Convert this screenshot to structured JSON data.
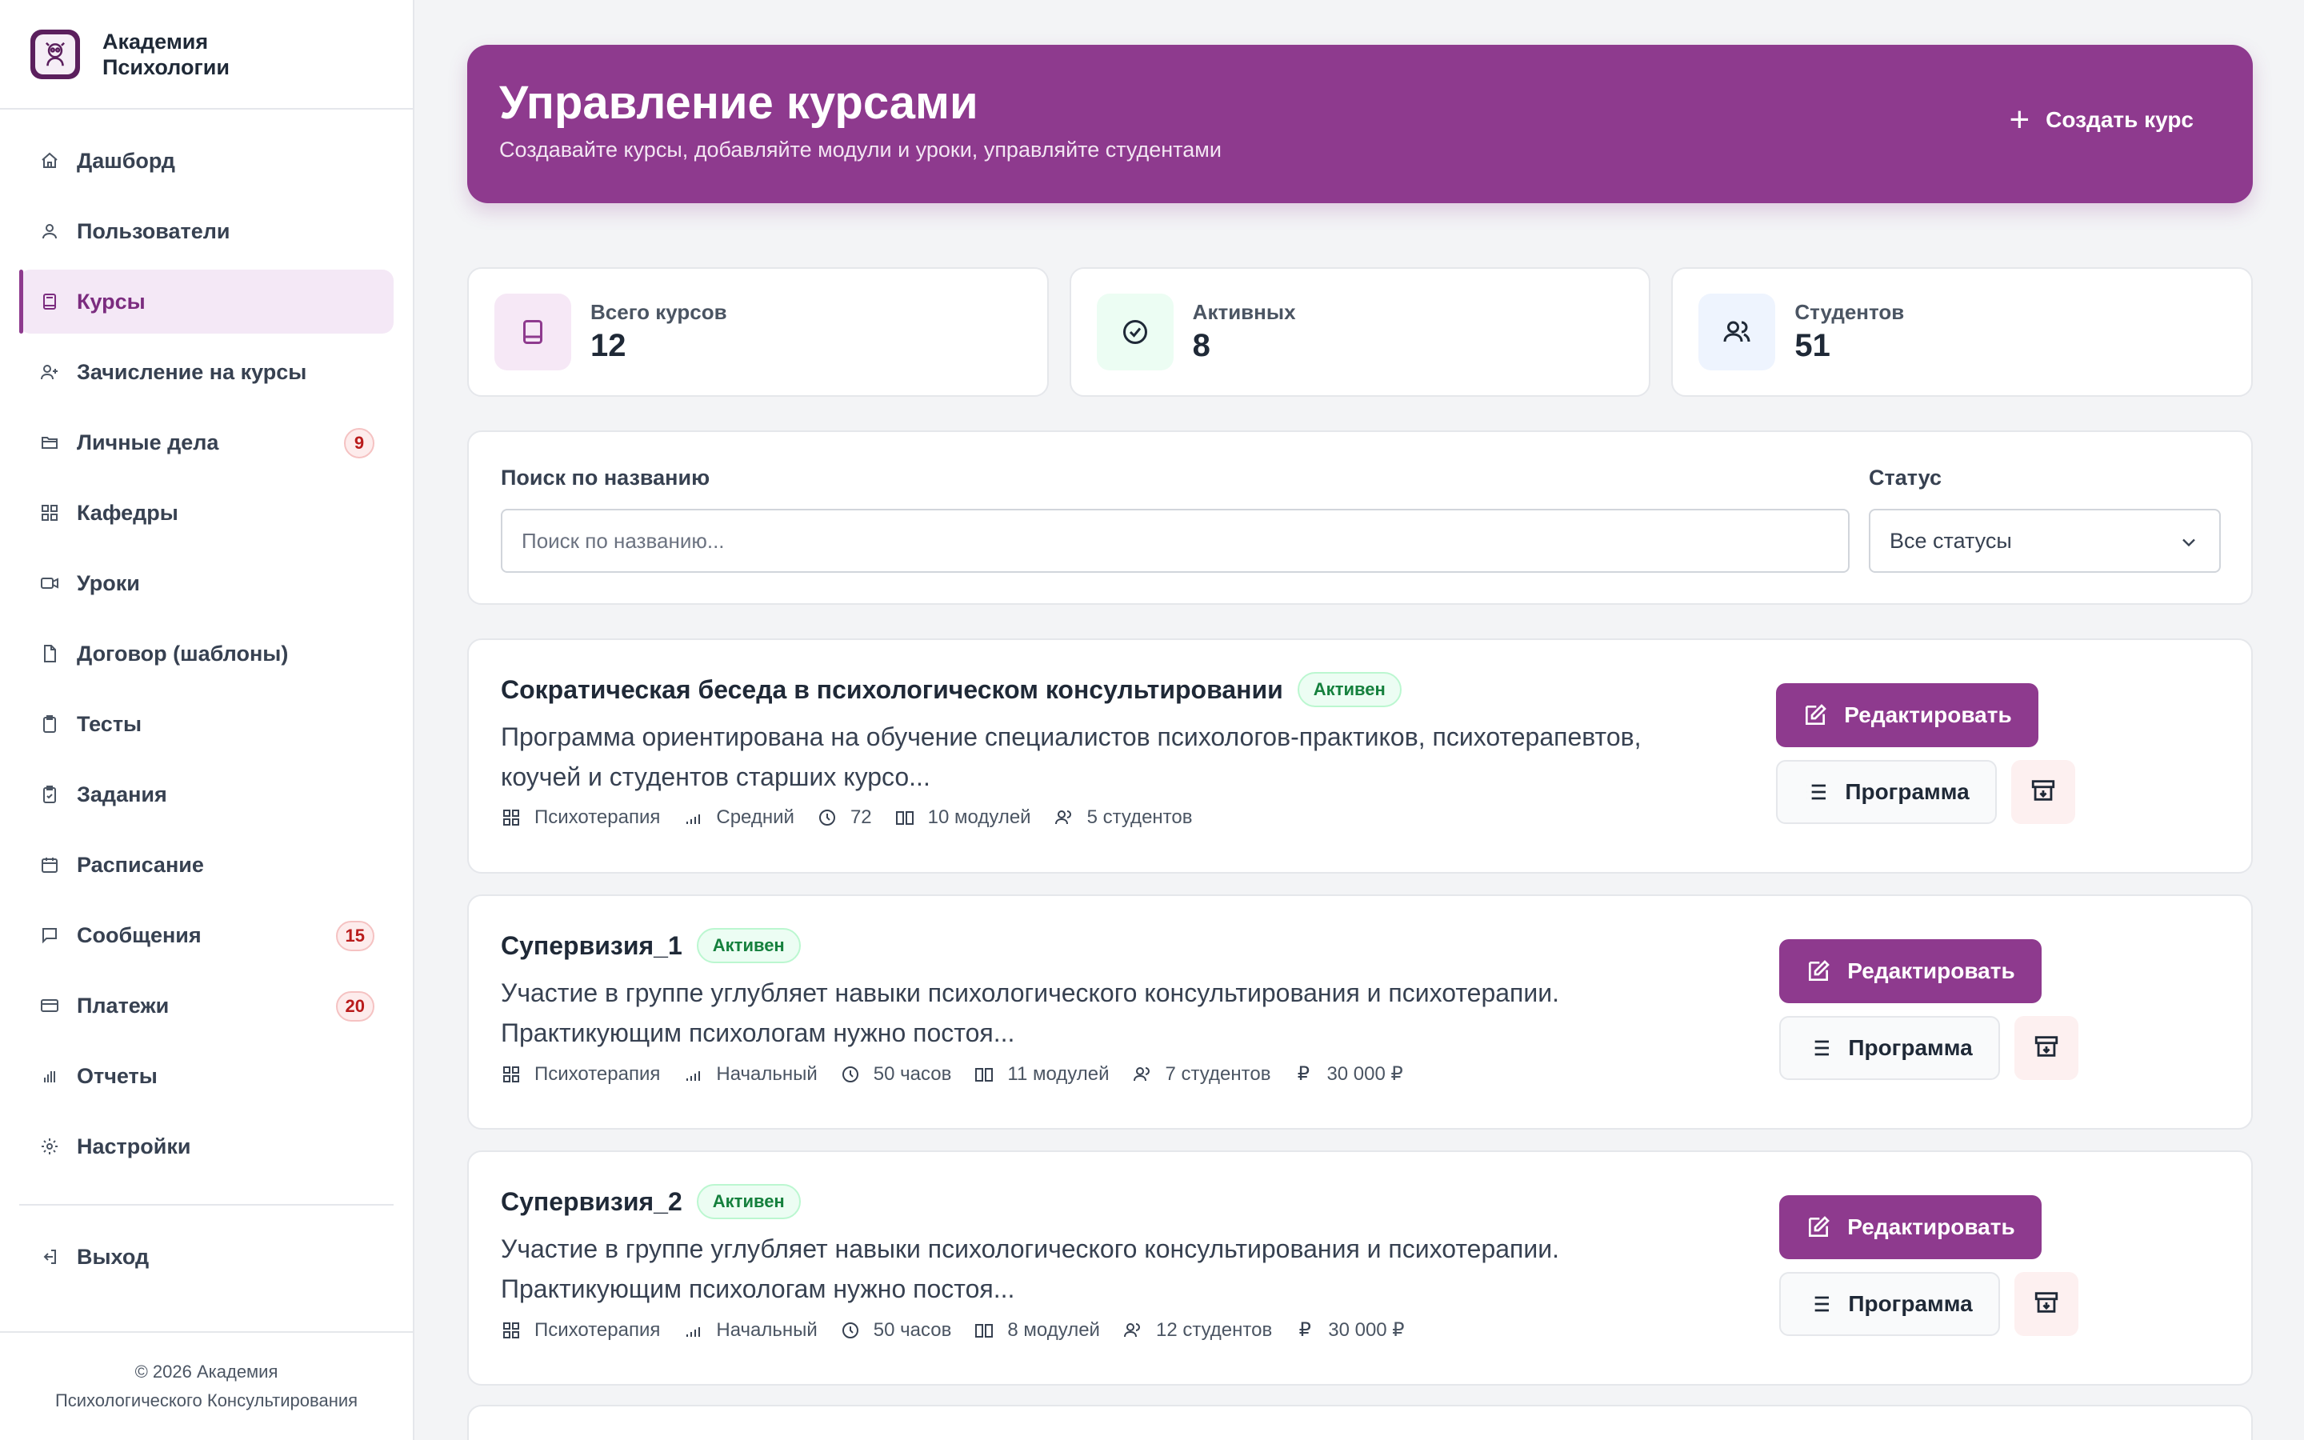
{
  "brand": {
    "title": "Академия Психологии"
  },
  "sidebar": {
    "items": [
      {
        "label": "Дашборд",
        "icon": "home-icon"
      },
      {
        "label": "Пользователи",
        "icon": "user-icon"
      },
      {
        "label": "Курсы",
        "icon": "book-icon",
        "active": true
      },
      {
        "label": "Зачисление на курсы",
        "icon": "user-plus-icon"
      },
      {
        "label": "Личные дела",
        "icon": "folder-icon",
        "badge": "9"
      },
      {
        "label": "Кафедры",
        "icon": "grid-icon"
      },
      {
        "label": "Уроки",
        "icon": "video-icon"
      },
      {
        "label": "Договор (шаблоны)",
        "icon": "file-icon"
      },
      {
        "label": "Тесты",
        "icon": "clipboard-icon"
      },
      {
        "label": "Задания",
        "icon": "clipboard-check-icon"
      },
      {
        "label": "Расписание",
        "icon": "calendar-icon"
      },
      {
        "label": "Сообщения",
        "icon": "message-icon",
        "badge": "15"
      },
      {
        "label": "Платежи",
        "icon": "credit-card-icon",
        "badge": "20"
      },
      {
        "label": "Отчеты",
        "icon": "bar-chart-icon"
      },
      {
        "label": "Настройки",
        "icon": "gear-icon"
      }
    ],
    "logout": "Выход",
    "footer_line1": "© 2026 Академия",
    "footer_line2": "Психологического Консультирования"
  },
  "header": {
    "title": "Управление курсами",
    "subtitle": "Создавайте курсы, добавляйте модули и уроки, управляйте студентами",
    "create_label": "Создать курс"
  },
  "stats": [
    {
      "label": "Всего курсов",
      "value": "12",
      "icon": "book-icon",
      "bg": "#f6e8f6"
    },
    {
      "label": "Активных",
      "value": "8",
      "icon": "check-circle-icon",
      "bg": "#ecfdf3"
    },
    {
      "label": "Студентов",
      "value": "51",
      "icon": "users-icon",
      "bg": "#eef4fe"
    }
  ],
  "filters": {
    "search_label": "Поиск по названию",
    "search_placeholder": "Поиск по названию...",
    "status_label": "Статус",
    "status_value": "Все статусы"
  },
  "courses": [
    {
      "title": "Сократическая беседа в психологическом консультировании",
      "status": "Активен",
      "description": "Программа ориентирована на обучение специалистов психологов-практиков, психотерапевтов, коучей и студентов старших курсо...",
      "category": "Психотерапия",
      "level": "Средний",
      "duration": "72",
      "modules": "10 модулей",
      "students": "5 студентов",
      "price": ""
    },
    {
      "title": "Супервизия_1",
      "status": "Активен",
      "description": "Участие в группе углубляет навыки психологического консультирования и психотерапии. Практикующим психологам нужно постоя...",
      "category": "Психотерапия",
      "level": "Начальный",
      "duration": "50 часов",
      "modules": "11 модулей",
      "students": "7 студентов",
      "price": "30 000 ₽"
    },
    {
      "title": "Супервизия_2",
      "status": "Активен",
      "description": "Участие в группе углубляет навыки психологического консультирования и психотерапии. Практикующим психологам нужно постоя...",
      "category": "Психотерапия",
      "level": "Начальный",
      "duration": "50 часов",
      "modules": "8 модулей",
      "students": "12 студентов",
      "price": "30 000 ₽"
    }
  ],
  "actions": {
    "edit": "Редактировать",
    "program": "Программа"
  },
  "colors": {
    "accent": "#8e3a8e",
    "active_bg": "#f4e8f6",
    "badge": "#b91c1c",
    "status_green": "#15803d"
  }
}
